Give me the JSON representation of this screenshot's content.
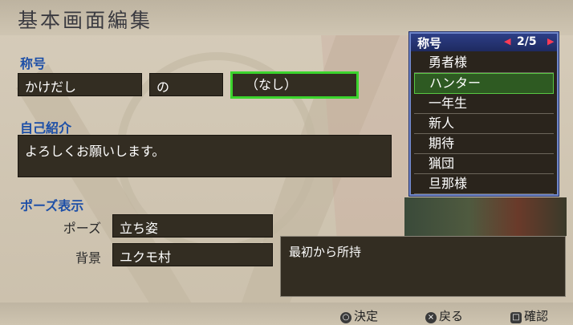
{
  "screen_title": "基本画面編集",
  "title_section": {
    "label": "称号",
    "word1": "かけだし",
    "connector": "の",
    "word2": "（なし）"
  },
  "intro_section": {
    "label": "自己紹介",
    "text": "よろしくお願いします。"
  },
  "pose_section": {
    "label": "ポーズ表示",
    "pose_label": "ポーズ",
    "pose_value": "立ち姿",
    "bg_label": "背景",
    "bg_value": "ユクモ村"
  },
  "help_text": "最初から所持",
  "popup": {
    "title": "称号",
    "page": "2/5",
    "items": [
      "勇者様",
      "ハンター",
      "一年生",
      "新人",
      "期待",
      "猟団",
      "旦那様"
    ],
    "selected_index": 1
  },
  "footer": {
    "confirm_icon": "○",
    "confirm": "決定",
    "back_icon": "×",
    "back": "戻る",
    "check_icon": "□",
    "check": "確認"
  },
  "colors": {
    "label_blue": "#1d4fa7",
    "selection_green": "#3bd42d",
    "field_bg": "#332d22"
  }
}
